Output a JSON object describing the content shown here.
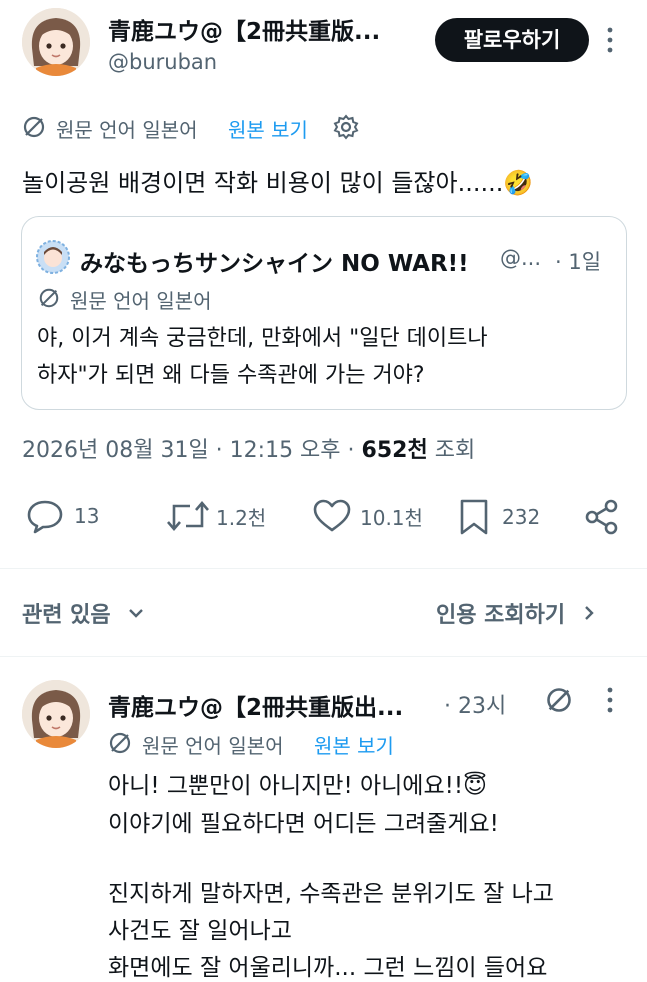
{
  "post": {
    "author_name": "青鹿ユウ@【2冊共重版...",
    "author_handle": "@buruban",
    "follow_label": "팔로우하기",
    "translation_note": "원문 언어 일본어",
    "show_original": "원본 보기",
    "text": "놀이공원 배경이면 작화 비용이 많이 들잖아......🤣",
    "timestamp": "2026년 08월 31일 · 12:15 오후 ·",
    "views_count": "652천",
    "views_label": "조회"
  },
  "quote": {
    "author_name": "みなもっちサンシャイン NO WAR!!",
    "handle": "@...",
    "time": "· 1일",
    "translation_note": "원문 언어 일본어",
    "text_line1": "야, 이거 계속 궁금한데, 만화에서 \"일단 데이트나",
    "text_line2": "하자\"가 되면 왜 다들 수족관에 가는 거야?"
  },
  "actions": {
    "replies": "13",
    "reposts": "1.2천",
    "likes": "10.1천",
    "bookmarks": "232"
  },
  "related": {
    "label": "관련 있음",
    "quote_views": "인용 조회하기"
  },
  "reply": {
    "author_name": "青鹿ユウ@【2冊共重版出...",
    "time": "· 23시",
    "translation_note": "원문 언어 일본어",
    "show_original": "원본 보기",
    "line1": "아니! 그뿐만이 아니지만! 아니에요!!😇",
    "line2": "이야기에 필요하다면 어디든 그려줄게요!",
    "line3": "진지하게 말하자면, 수족관은 분위기도 잘 나고",
    "line4": "사건도 잘 일어나고",
    "line5": "화면에도 잘 어울리니까... 그런 느낌이 들어요"
  },
  "colors": {
    "text": "#0f1419",
    "secondary": "#536471",
    "link": "#1d9bf0",
    "border": "#cfd9de"
  }
}
